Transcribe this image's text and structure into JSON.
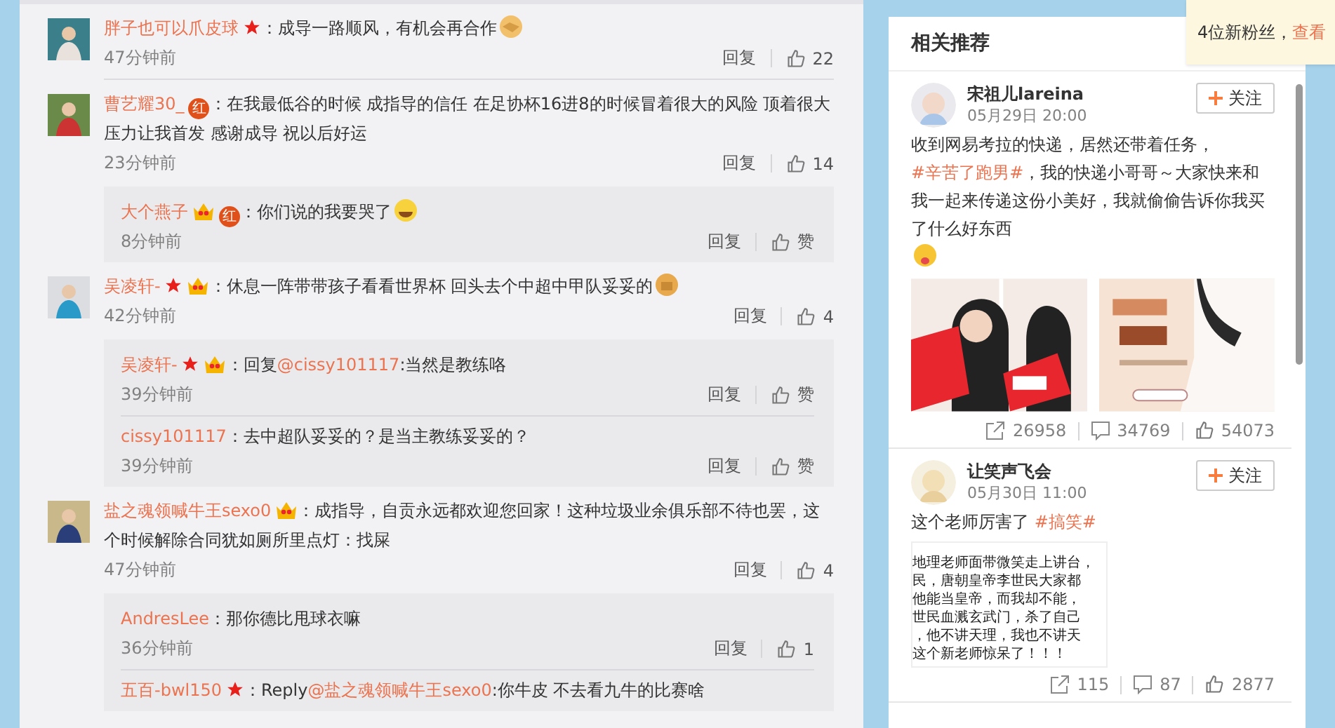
{
  "comments": [
    {
      "name": "胖子也可以爪皮球",
      "badges": [
        {
          "kind": "star"
        }
      ],
      "parts": [
        {
          "kind": "plain",
          "text": "：成导一路顺风，有机会再合作"
        }
      ],
      "emoji": {
        "kind": "handshake"
      },
      "time": "47分钟前",
      "reply": "回复",
      "like": "22"
    },
    {
      "name": "曹艺耀30_",
      "badges": [
        {
          "kind": "red",
          "text": "红"
        }
      ],
      "parts": [
        {
          "kind": "plain",
          "text": "：在我最低谷的时候 成指导的信任 在足协杯16进8的时候冒着很大的风险 顶着很大压力让我首发 感谢成导 祝以后好运"
        }
      ],
      "time": "23分钟前",
      "reply": "回复",
      "like": "14",
      "replies": [
        {
          "name": "大个燕子",
          "badges": [
            {
              "kind": "vip"
            },
            {
              "kind": "red",
              "text": "红"
            }
          ],
          "parts": [
            {
              "kind": "plain",
              "text": "：你们说的我要哭了"
            }
          ],
          "emoji": {
            "kind": "laugh"
          },
          "time": "8分钟前",
          "reply": "回复",
          "like": "赞"
        }
      ]
    },
    {
      "name": "吴凌轩-",
      "badges": [
        {
          "kind": "star"
        },
        {
          "kind": "vip"
        }
      ],
      "parts": [
        {
          "kind": "plain",
          "text": "：休息一阵带带孩子看看世界杯 回头去个中超中甲队妥妥的"
        }
      ],
      "emoji": {
        "kind": "fist"
      },
      "time": "42分钟前",
      "reply": "回复",
      "like": "4",
      "replies": [
        {
          "name": "吴凌轩-",
          "badges": [
            {
              "kind": "star"
            },
            {
              "kind": "vip"
            }
          ],
          "parts": [
            {
              "kind": "plain",
              "text": "：回复"
            },
            {
              "kind": "mention",
              "text": "@cissy101117"
            },
            {
              "kind": "plain",
              "text": ":当然是教练咯"
            }
          ],
          "time": "39分钟前",
          "reply": "回复",
          "like": "赞"
        },
        {
          "name": "cissy101117",
          "parts": [
            {
              "kind": "plain",
              "text": "：去中超队妥妥的？是当主教练妥妥的？"
            }
          ],
          "time": "39分钟前",
          "reply": "回复",
          "like": "赞"
        }
      ]
    },
    {
      "name": "盐之魂领喊牛王sexo0",
      "badges": [
        {
          "kind": "vip"
        }
      ],
      "parts": [
        {
          "kind": "plain",
          "text": "：成指导，自贡永远都欢迎您回家！这种垃圾业余俱乐部不待也罢，这个时候解除合同犹如厕所里点灯：找屎"
        }
      ],
      "time": "47分钟前",
      "reply": "回复",
      "like": "4",
      "replies": [
        {
          "name": "AndresLee",
          "parts": [
            {
              "kind": "plain",
              "text": "：那你德比甩球衣嘛"
            }
          ],
          "time": "36分钟前",
          "reply": "回复",
          "like": "1"
        },
        {
          "name": "五百-bwl150",
          "badges": [
            {
              "kind": "star"
            }
          ],
          "parts": [
            {
              "kind": "plain",
              "text": "：Reply"
            },
            {
              "kind": "mention",
              "text": "@盐之魂领喊牛王sexo0"
            },
            {
              "kind": "plain",
              "text": ":你牛皮 不去看九牛的比赛啥"
            }
          ]
        }
      ]
    }
  ],
  "sidebar": {
    "title": "相关推荐",
    "posts": [
      {
        "author": "宋祖儿lareina",
        "date": "05月29日 20:00",
        "follow": "关注",
        "parts": [
          {
            "kind": "plain",
            "text": "收到网易考拉的快递，居然还带着任务，"
          },
          {
            "kind": "topic",
            "text": "#辛苦了"
          },
          {
            "kind": "topic",
            "text": "跑男#"
          },
          {
            "kind": "plain",
            "text": "，我的快递小哥哥～大家快来和我一起来传递这份小美好，我就偷偷告诉你我买了什么好东西"
          }
        ],
        "emoji": {
          "kind": "tongue"
        },
        "media": {
          "kind": "photos"
        },
        "shares": "26958",
        "comments": "34769",
        "likes": "54073"
      },
      {
        "author": "让笑声飞会",
        "date": "05月30日 11:00",
        "follow": "关注",
        "parts": [
          {
            "kind": "plain",
            "text": "这个老师厉害了 "
          },
          {
            "kind": "topic",
            "text": "#搞笑#"
          }
        ],
        "media": {
          "kind": "text_image",
          "lines": [
            "地理老师面带微笑走上讲台，",
            "民，唐朝皇帝李世民大家都",
            "他能当皇帝，而我却不能，",
            "世民血溅玄武门，杀了自己",
            "，他不讲天理，我也不讲天",
            "这个新老师惊呆了！！！"
          ]
        },
        "shares": "115",
        "comments": "87",
        "likes": "2877"
      }
    ]
  },
  "notice": {
    "text": "4位新粉丝，",
    "link": "查看"
  }
}
